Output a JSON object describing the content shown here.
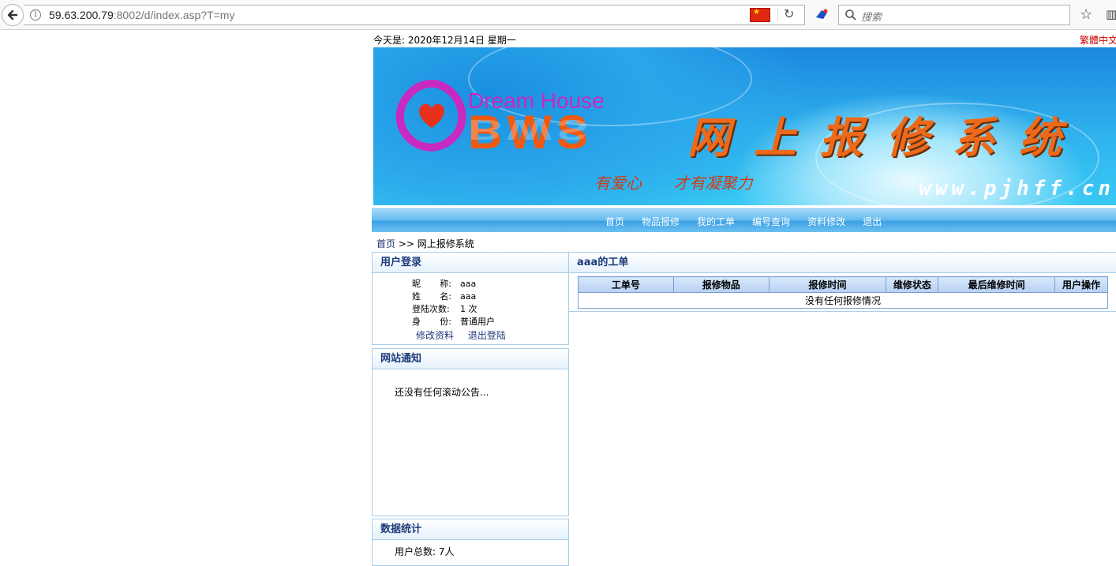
{
  "browser": {
    "url_host": "59.63.200.79",
    "url_rest": ":8002/d/index.asp?T=my",
    "search_placeholder": "搜索"
  },
  "header": {
    "date_text": "今天是: 2020年12月14日 星期一",
    "traditional_link": "繁體中文"
  },
  "banner": {
    "brand_line": "Dream House",
    "brand_logo_text": "BWS",
    "system_title": "网上报修系统",
    "slogan": "有爱心 才有凝聚力",
    "site_url": "www.pjhff.cn"
  },
  "nav": {
    "items": [
      "首页",
      "物品报修",
      "我的工单",
      "编号查询",
      "资料修改",
      "退出"
    ]
  },
  "breadcrumb": {
    "home": "首页",
    "separator": " >> ",
    "current": "网上报修系统"
  },
  "login_panel": {
    "title": "用户登录",
    "nickname_label_a": "昵",
    "nickname_label_b": "称:",
    "nickname_value": "aaa",
    "name_label_a": "姓",
    "name_label_b": "名:",
    "name_value": "aaa",
    "login_count_label": "登陆次数:",
    "login_count_value": "1 次",
    "identity_label_a": "身",
    "identity_label_b": "份:",
    "identity_value": "普通用户",
    "edit_link": "修改资料",
    "logout_link": "退出登陆"
  },
  "notice_panel": {
    "title": "网站通知",
    "content": "还没有任何滚动公告..."
  },
  "stats_panel": {
    "title": "数据统计",
    "users_total": "用户总数: 7人"
  },
  "orders": {
    "title": "aaa的工单",
    "columns": [
      "工单号",
      "报修物品",
      "报修时间",
      "维修状态",
      "最后维修时间",
      "用户操作"
    ],
    "empty_text": "没有任何报修情况"
  },
  "colors": {
    "panel_title": "#1c3a7a",
    "traditional_link": "#cc0000",
    "banner_title": "#ee6a1a"
  }
}
